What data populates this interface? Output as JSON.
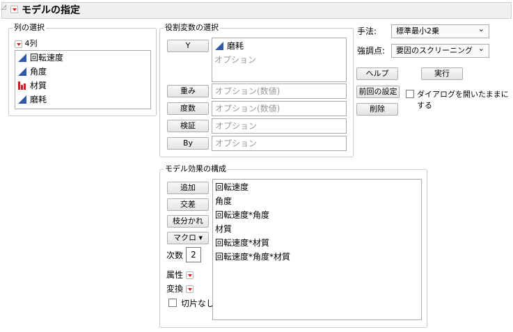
{
  "header": {
    "title": "モデルの指定",
    "collapse_icon": "collapse-triangle-icon",
    "menu_icon": "red-triangle-menu-icon"
  },
  "columns": {
    "group_label": "列の選択",
    "count_label": "4列",
    "items": [
      {
        "label": "回転速度",
        "type": "continuous"
      },
      {
        "label": "角度",
        "type": "continuous"
      },
      {
        "label": "材質",
        "type": "nominal"
      },
      {
        "label": "磨耗",
        "type": "continuous"
      }
    ]
  },
  "roles": {
    "group_label": "役割変数の選択",
    "y": {
      "button": "Y",
      "value": "磨耗",
      "placeholder": "オプション"
    },
    "weight": {
      "button": "重み",
      "placeholder": "オプション(数値)"
    },
    "freq": {
      "button": "度数",
      "placeholder": "オプション(数値)"
    },
    "validation": {
      "button": "検証",
      "placeholder": "オプション"
    },
    "by": {
      "button": "By",
      "placeholder": "オプション"
    }
  },
  "options": {
    "method_label": "手法:",
    "method_value": "標準最小2乗",
    "emphasis_label": "強調点:",
    "emphasis_value": "要因のスクリーニング",
    "help_button": "ヘルプ",
    "run_button": "実行",
    "recall_button": "前回の設定",
    "keep_open_label": "ダイアログを開いたままにする",
    "remove_button": "削除"
  },
  "effects": {
    "group_label": "モデル効果の構成",
    "add_button": "追加",
    "cross_button": "交差",
    "nest_button": "枝分かれ",
    "macro_button": "マクロ ▾",
    "degree_label": "次数",
    "degree_value": "2",
    "attributes_label": "属性",
    "transform_label": "変換",
    "no_intercept_label": "切片なし",
    "items": [
      "回転速度",
      "角度",
      "回転速度*角度",
      "材質",
      "回転速度*材質",
      "回転速度*角度*材質"
    ]
  },
  "colors": {
    "continuous_icon": "#2f58a8",
    "nominal_icon": "#c62424",
    "menu_triangle": "#d21a1a"
  }
}
